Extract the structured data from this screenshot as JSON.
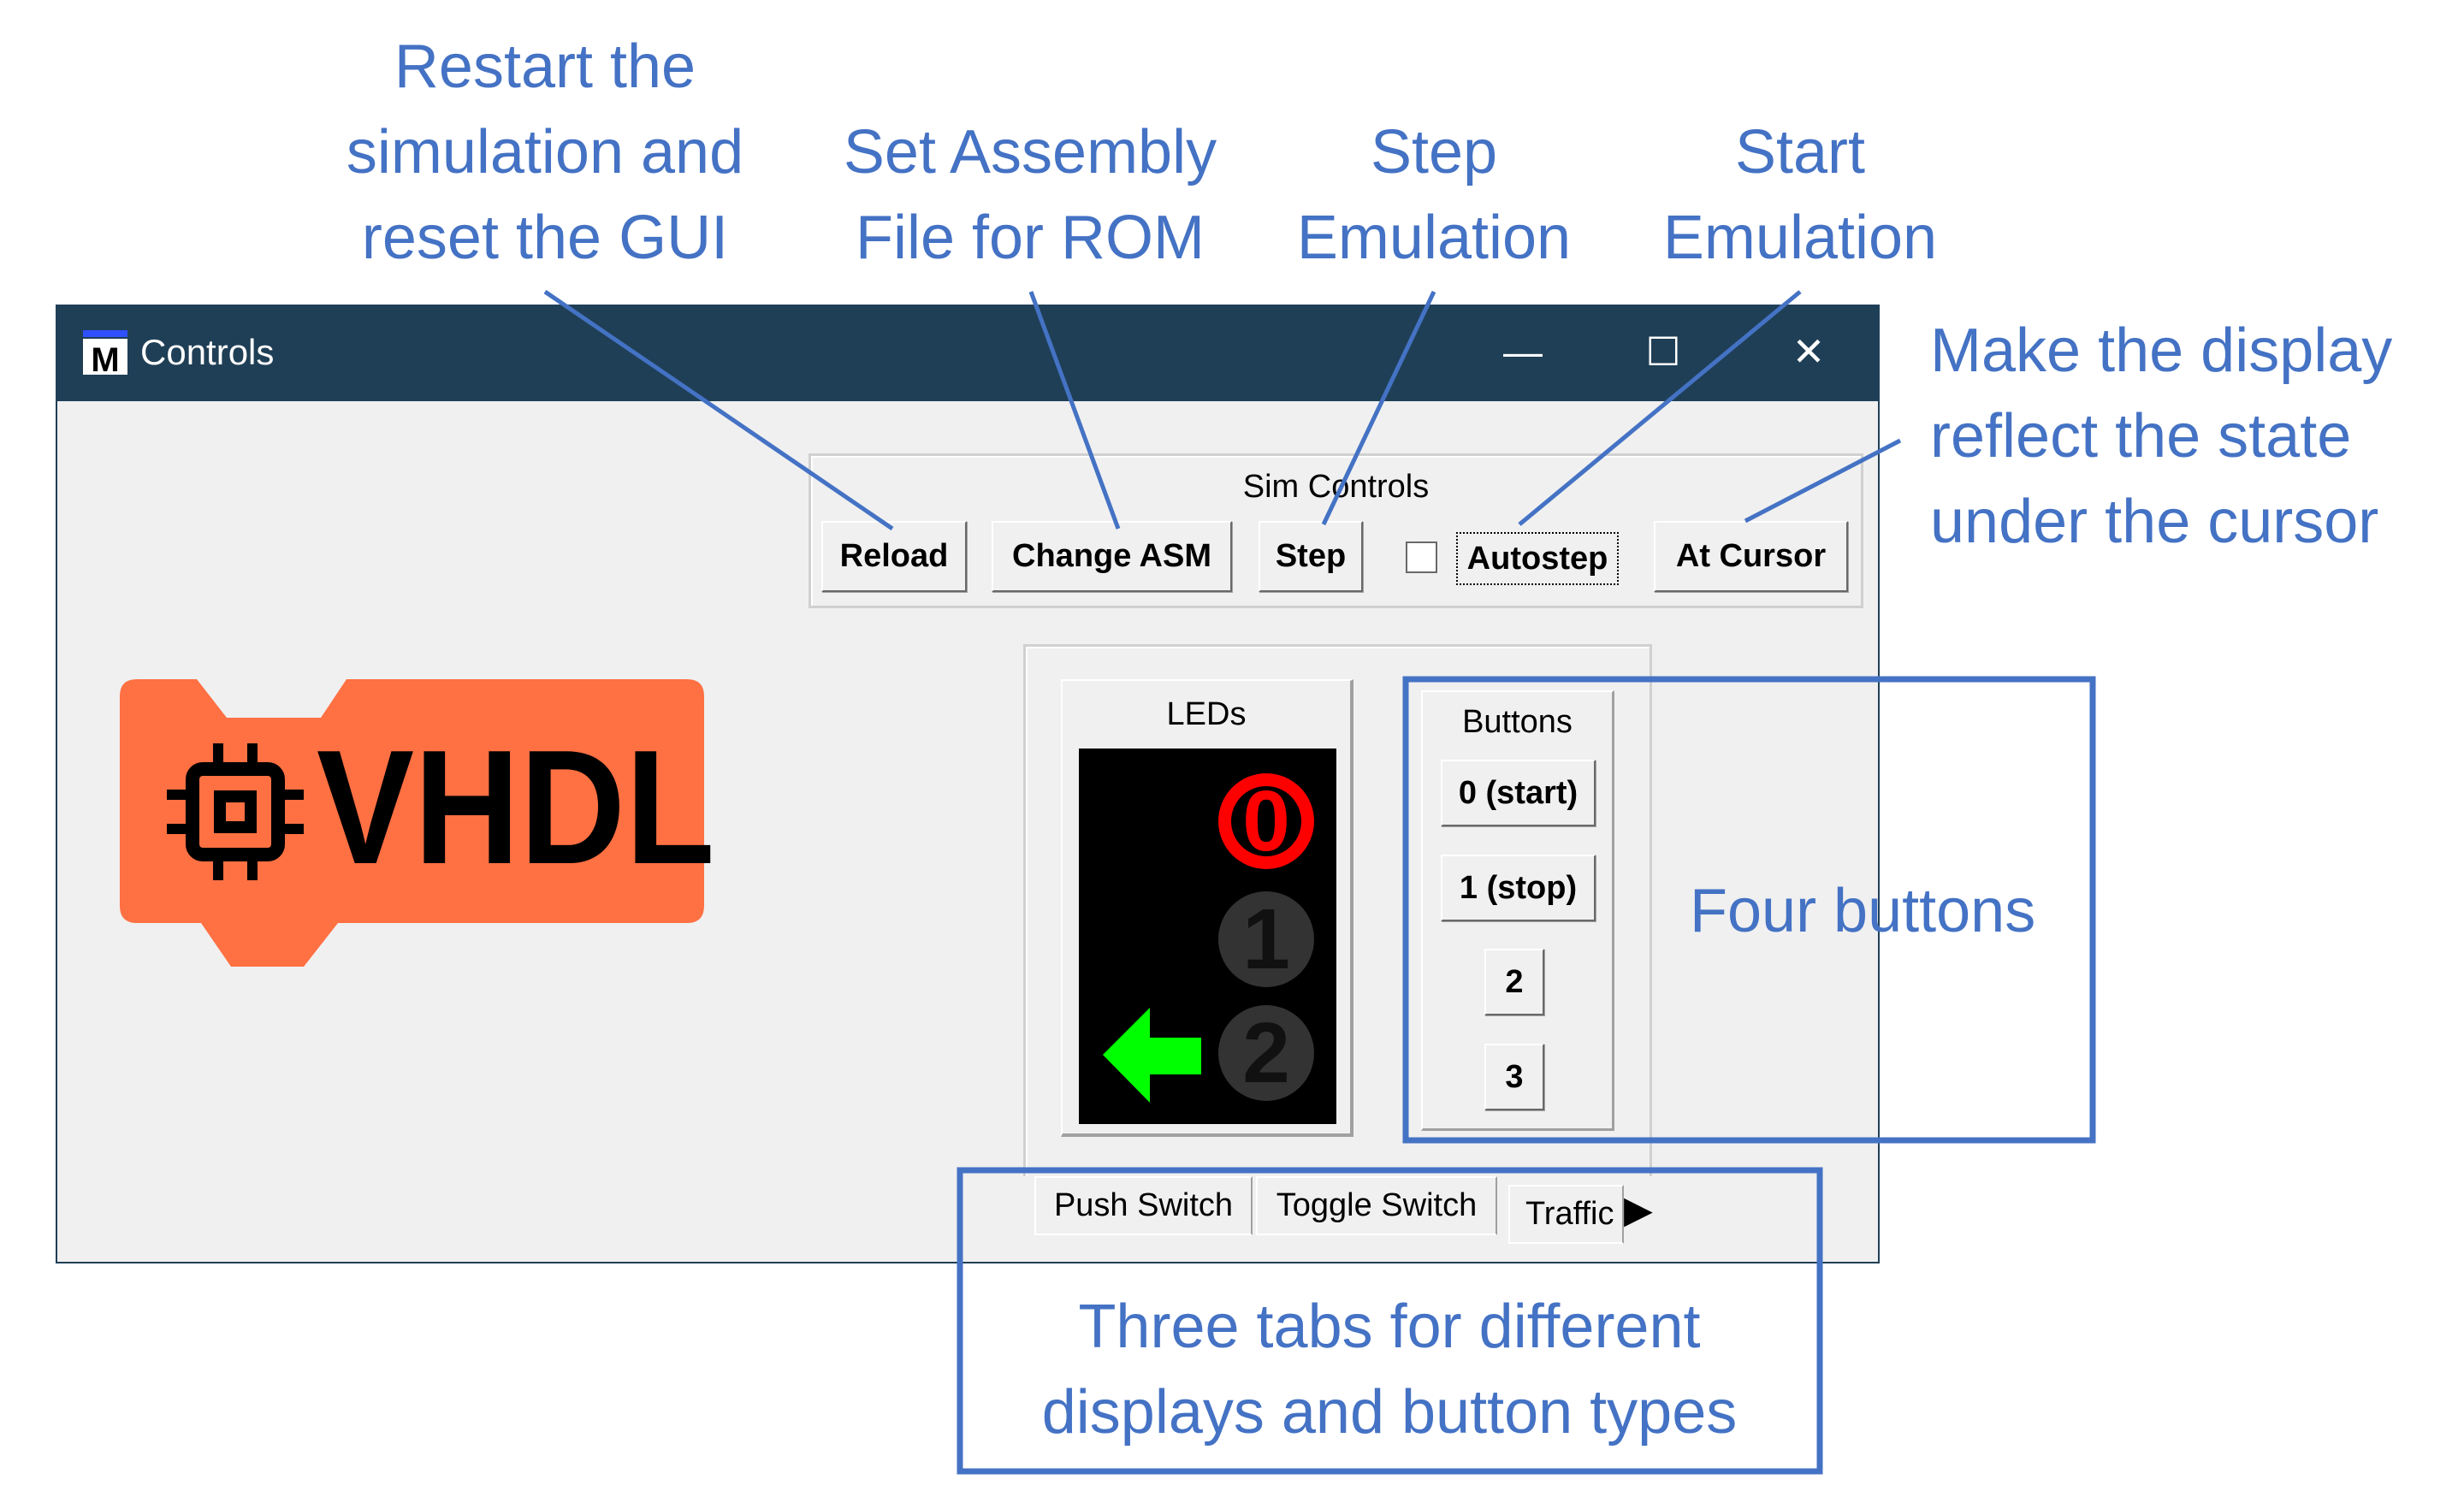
{
  "window": {
    "title": "Controls",
    "app_icon": "m-app-icon",
    "controls": {
      "minimize": "—",
      "maximize": "☐",
      "close": "✕"
    }
  },
  "sim_controls": {
    "label": "Sim Controls",
    "reload": "Reload",
    "change_asm": "Change ASM",
    "step": "Step",
    "autostep": "Autostep",
    "autostep_checked": false,
    "at_cursor": "At Cursor"
  },
  "logo": {
    "text": "VHDL",
    "icon": "chip-icon",
    "color": "#ff7043"
  },
  "leds": {
    "label": "LEDs",
    "items": [
      {
        "label": "0",
        "state": "on",
        "color": "#ff0000"
      },
      {
        "label": "1",
        "state": "off"
      },
      {
        "label": "2",
        "state": "off"
      }
    ],
    "arrow": "left-arrow-green"
  },
  "buttons": {
    "label": "Buttons",
    "items": [
      "0 (start)",
      "1 (stop)",
      "2",
      "3"
    ]
  },
  "tabs": [
    "Push Switch",
    "Toggle Switch",
    "Traffic"
  ],
  "annotations": {
    "reload": [
      "Restart the",
      "simulation and",
      "reset the GUI"
    ],
    "change_asm": [
      "Set Assembly",
      "File for ROM"
    ],
    "step": [
      "Step",
      "Emulation"
    ],
    "autostep": [
      "Start",
      "Emulation"
    ],
    "at_cursor": [
      "Make the display",
      "reflect the state",
      "under the cursor"
    ],
    "buttons": "Four buttons",
    "tabs": [
      "Three tabs for different",
      "displays and button types"
    ],
    "color": "#4472c4"
  }
}
